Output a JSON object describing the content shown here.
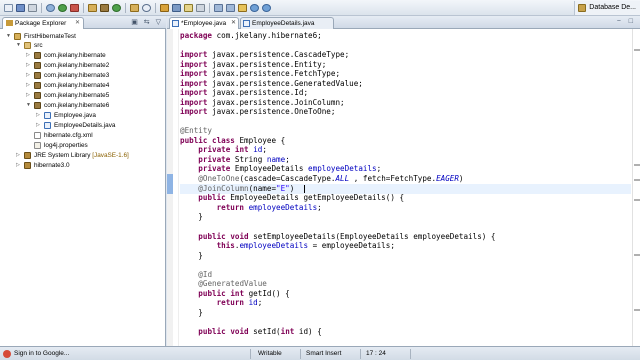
{
  "toolbar": {
    "perspective_label": "Database De..."
  },
  "explorer": {
    "tab_label": "Package Explorer",
    "tab_close": "✕",
    "tools": "▣ ⇆ ▽",
    "items": [
      {
        "label": "FirstHibernateTest",
        "icon": "project-icon"
      },
      {
        "label": "src",
        "icon": "source-folder-icon"
      },
      {
        "label": "com.jkelany.hibernate",
        "icon": "package-icon"
      },
      {
        "label": "com.jkelany.hibernate2",
        "icon": "package-icon"
      },
      {
        "label": "com.jkelany.hibernate3",
        "icon": "package-icon"
      },
      {
        "label": "com.jkelany.hibernate4",
        "icon": "package-icon"
      },
      {
        "label": "com.jkelany.hibernate5",
        "icon": "package-icon"
      },
      {
        "label": "com.jkelany.hibernate6",
        "icon": "package-icon"
      },
      {
        "label": "Employee.java",
        "icon": "java-file-icon"
      },
      {
        "label": "EmployeeDetails.java",
        "icon": "java-file-icon"
      },
      {
        "label": "hibernate.cfg.xml",
        "icon": "xml-file-icon"
      },
      {
        "label": "log4j.properties",
        "icon": "properties-file-icon"
      },
      {
        "label": "JRE System Library",
        "suffix": "[JavaSE-1.6]",
        "icon": "library-icon"
      },
      {
        "label": "hibernate3.0",
        "icon": "library-icon"
      }
    ]
  },
  "editor": {
    "tabs": [
      {
        "label": "*Employee.java",
        "active": true,
        "close": "✕"
      },
      {
        "label": "EmployeeDetails.java",
        "active": false,
        "close": ""
      }
    ],
    "controls": "− □",
    "code": {
      "l1_kw": "package",
      "l1_rest": " com.jkelany.hibernate6;",
      "imp_kw": "import",
      "imports": [
        " javax.persistence.CascadeType;",
        " javax.persistence.Entity;",
        " javax.persistence.FetchType;",
        " javax.persistence.GeneratedValue;",
        " javax.persistence.Id;",
        " javax.persistence.JoinColumn;",
        " javax.persistence.OneToOne;"
      ],
      "entity": "@Entity",
      "class_kw1": "public",
      "class_kw2": "class",
      "class_name": " Employee {",
      "f1_kw1": "private",
      "f1_kw2": "int",
      "f1_name": "id",
      "f1_end": ";",
      "f2_kw": "private",
      "f2_type": " String ",
      "f2_name": "name",
      "f2_end": ";",
      "f3_kw": "private",
      "f3_type": " EmployeeDetails ",
      "f3_name": "employeeDetails",
      "f3_end": ";",
      "o2o_ann": "@OneToOne",
      "o2o_a": "(cascade=CascadeType.",
      "o2o_all": "ALL",
      "o2o_b": " , fetch=FetchType.",
      "o2o_eager": "EAGER",
      "o2o_c": ")",
      "jc_ann": "@JoinColumn",
      "jc_a": "(name=",
      "jc_str": "\"E\"",
      "jc_b": ")",
      "get_kw": "public",
      "get_rest": " EmployeeDetails getEmployeeDetails() {",
      "ret_kw": "return",
      "ret_fld": " employeeDetails",
      "ret_end": ";",
      "close": "}",
      "set_kw1": "public",
      "set_kw2": "void",
      "set_rest": " setEmployeeDetails(EmployeeDetails employeeDetails) {",
      "this_kw": "this",
      "this_dot": ".",
      "this_fld": "employeeDetails",
      "this_rest": " = employeeDetails;",
      "id_ann": "@Id",
      "gv_ann": "@GeneratedValue",
      "gid_kw1": "public",
      "gid_kw2": "int",
      "gid_rest": " getId() {",
      "rid_kw": "return",
      "rid_fld": " id",
      "rid_end": ";",
      "sid_kw1": "public",
      "sid_kw2": "void",
      "sid_rest": " setId(",
      "sid_kw3": "int",
      "sid_rest2": " id) {"
    }
  },
  "status": {
    "sign_in": "Sign in to Google...",
    "mode": "Writable",
    "insert": "Smart Insert",
    "position": "17 : 24"
  }
}
